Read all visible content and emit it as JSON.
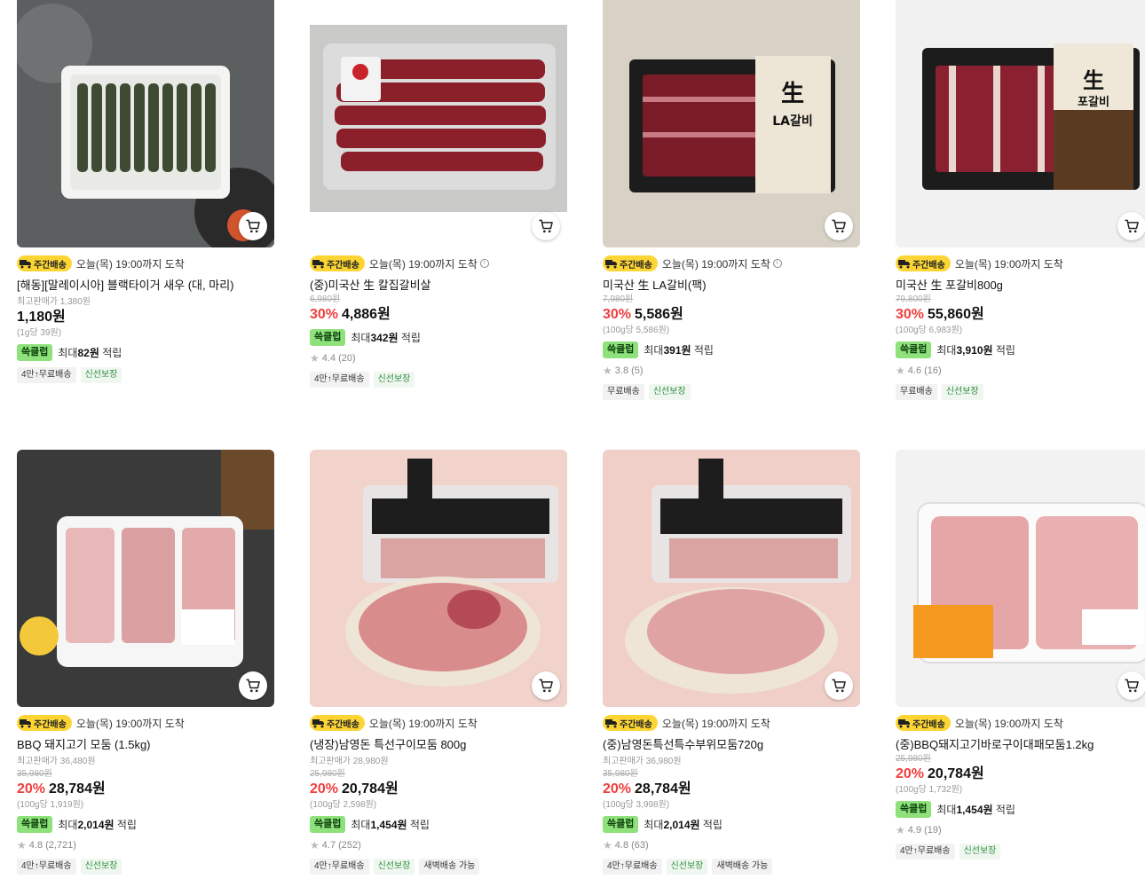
{
  "common": {
    "weekly_badge": "주간배송",
    "delivery_text": "오늘(목) 19:00까지 도착",
    "reward_badge": "쓱클럽",
    "reward_prefix": "최대",
    "reward_suffix": "적립"
  },
  "products": [
    {
      "name": "[해동][말레이시아] 블랙타이거 새우 (대, 마리)",
      "ref_price": "최고판매가 1,380원",
      "price": "1,180원",
      "unit_price": "(1g당 39원)",
      "reward_amount": "82원",
      "tags": [
        "4만↑무료배송",
        "신선보장"
      ]
    },
    {
      "name": "(중)미국산 生 칼집갈비살",
      "original_price": "6,980원",
      "discount": "30%",
      "price": "4,886원",
      "reward_amount": "342원",
      "rating": "4.4 (20)",
      "tags": [
        "4만↑무료배송",
        "신선보장"
      ]
    },
    {
      "name": "미국산 生 LA갈비(팩)",
      "original_price": "7,980원",
      "discount": "30%",
      "price": "5,586원",
      "unit_price": "(100g당 5,586원)",
      "reward_amount": "391원",
      "rating": "3.8 (5)",
      "tags": [
        "무료배송",
        "신선보장"
      ]
    },
    {
      "name": "미국산 生 포갈비800g",
      "original_price": "79,800원",
      "discount": "30%",
      "price": "55,860원",
      "unit_price": "(100g당 6,983원)",
      "reward_amount": "3,910원",
      "rating": "4.6 (16)",
      "tags": [
        "무료배송",
        "신선보장"
      ]
    },
    {
      "name": "BBQ 돼지고기 모둠 (1.5kg)",
      "ref_price": "최고판매가 36,480원",
      "original_price": "35,980원",
      "discount": "20%",
      "price": "28,784원",
      "unit_price": "(100g당 1,919원)",
      "reward_amount": "2,014원",
      "rating": "4.8 (2,721)",
      "tags": [
        "4만↑무료배송",
        "신선보장"
      ]
    },
    {
      "name": "(냉장)남영돈 특선구이모둠 800g",
      "ref_price": "최고판매가 28,980원",
      "original_price": "25,980원",
      "discount": "20%",
      "price": "20,784원",
      "unit_price": "(100g당 2,598원)",
      "reward_amount": "1,454원",
      "rating": "4.7 (252)",
      "tags": [
        "4만↑무료배송",
        "신선보장",
        "새벽배송 가능"
      ]
    },
    {
      "name": "(중)남영돈특선특수부위모둠720g",
      "ref_price": "최고판매가 36,980원",
      "original_price": "35,980원",
      "discount": "20%",
      "price": "28,784원",
      "unit_price": "(100g당 3,998원)",
      "reward_amount": "2,014원",
      "rating": "4.8 (63)",
      "tags": [
        "4만↑무료배송",
        "신선보장",
        "새벽배송 가능"
      ]
    },
    {
      "name": "(중)BBQ돼지고기바로구이대패모둠1.2kg",
      "original_price": "25,980원",
      "discount": "20%",
      "price": "20,784원",
      "unit_price": "(100g당 1,732원)",
      "reward_amount": "1,454원",
      "rating": "4.9 (19)",
      "tags": [
        "4만↑무료배송",
        "신선보장"
      ]
    }
  ],
  "colors": {
    "discount": "#f03e3e",
    "reward_badge_bg": "#8ee17b",
    "weekly_badge_bg": "#fcd535",
    "fresh_tag_text": "#2f8f3f"
  }
}
